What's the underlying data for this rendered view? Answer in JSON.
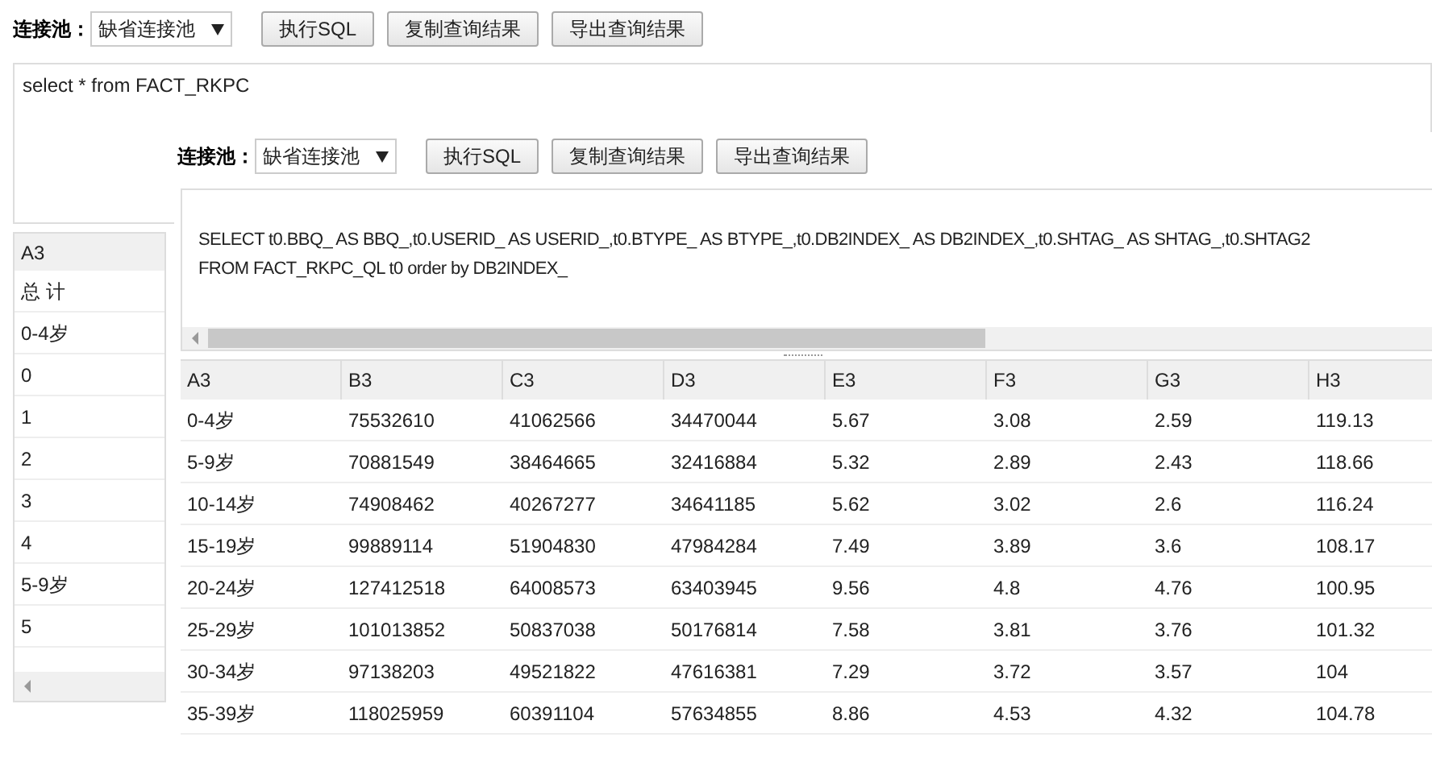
{
  "back_window": {
    "toolbar": {
      "pool_label": "连接池：",
      "pool_value": "缺省连接池",
      "buttons": [
        "执行SQL",
        "复制查询结果",
        "导出查询结果"
      ]
    },
    "editor": {
      "value": "select * from FACT_RKPC"
    },
    "results": {
      "columns": [
        "A3"
      ],
      "rows": [
        [
          "总 计"
        ],
        [
          "0-4岁"
        ],
        [
          "0"
        ],
        [
          "1"
        ],
        [
          "2"
        ],
        [
          "3"
        ],
        [
          "4"
        ],
        [
          "5-9岁"
        ],
        [
          "5"
        ]
      ]
    }
  },
  "front_window": {
    "toolbar": {
      "pool_label": "连接池：",
      "pool_value": "缺省连接池",
      "buttons": [
        "执行SQL",
        "复制查询结果",
        "导出查询结果"
      ]
    },
    "sql_lines": [
      "SELECT t0.BBQ_ AS BBQ_,t0.USERID_ AS USERID_,t0.BTYPE_ AS BTYPE_,t0.DB2INDEX_ AS DB2INDEX_,t0.SHTAG_ AS SHTAG_,t0.SHTAG2",
      "FROM FACT_RKPC_QL t0 order by DB2INDEX_"
    ],
    "results": {
      "columns": [
        "A3",
        "B3",
        "C3",
        "D3",
        "E3",
        "F3",
        "G3",
        "H3"
      ],
      "rows": [
        [
          "0-4岁",
          "75532610",
          "41062566",
          "34470044",
          "5.67",
          "3.08",
          "2.59",
          "119.13"
        ],
        [
          "5-9岁",
          "70881549",
          "38464665",
          "32416884",
          "5.32",
          "2.89",
          "2.43",
          "118.66"
        ],
        [
          "10-14岁",
          "74908462",
          "40267277",
          "34641185",
          "5.62",
          "3.02",
          "2.6",
          "116.24"
        ],
        [
          "15-19岁",
          "99889114",
          "51904830",
          "47984284",
          "7.49",
          "3.89",
          "3.6",
          "108.17"
        ],
        [
          "20-24岁",
          "127412518",
          "64008573",
          "63403945",
          "9.56",
          "4.8",
          "4.76",
          "100.95"
        ],
        [
          "25-29岁",
          "101013852",
          "50837038",
          "50176814",
          "7.58",
          "3.81",
          "3.76",
          "101.32"
        ],
        [
          "30-34岁",
          "97138203",
          "49521822",
          "47616381",
          "7.29",
          "3.72",
          "3.57",
          "104"
        ],
        [
          "35-39岁",
          "118025959",
          "60391104",
          "57634855",
          "8.86",
          "4.53",
          "4.32",
          "104.78"
        ]
      ]
    }
  }
}
